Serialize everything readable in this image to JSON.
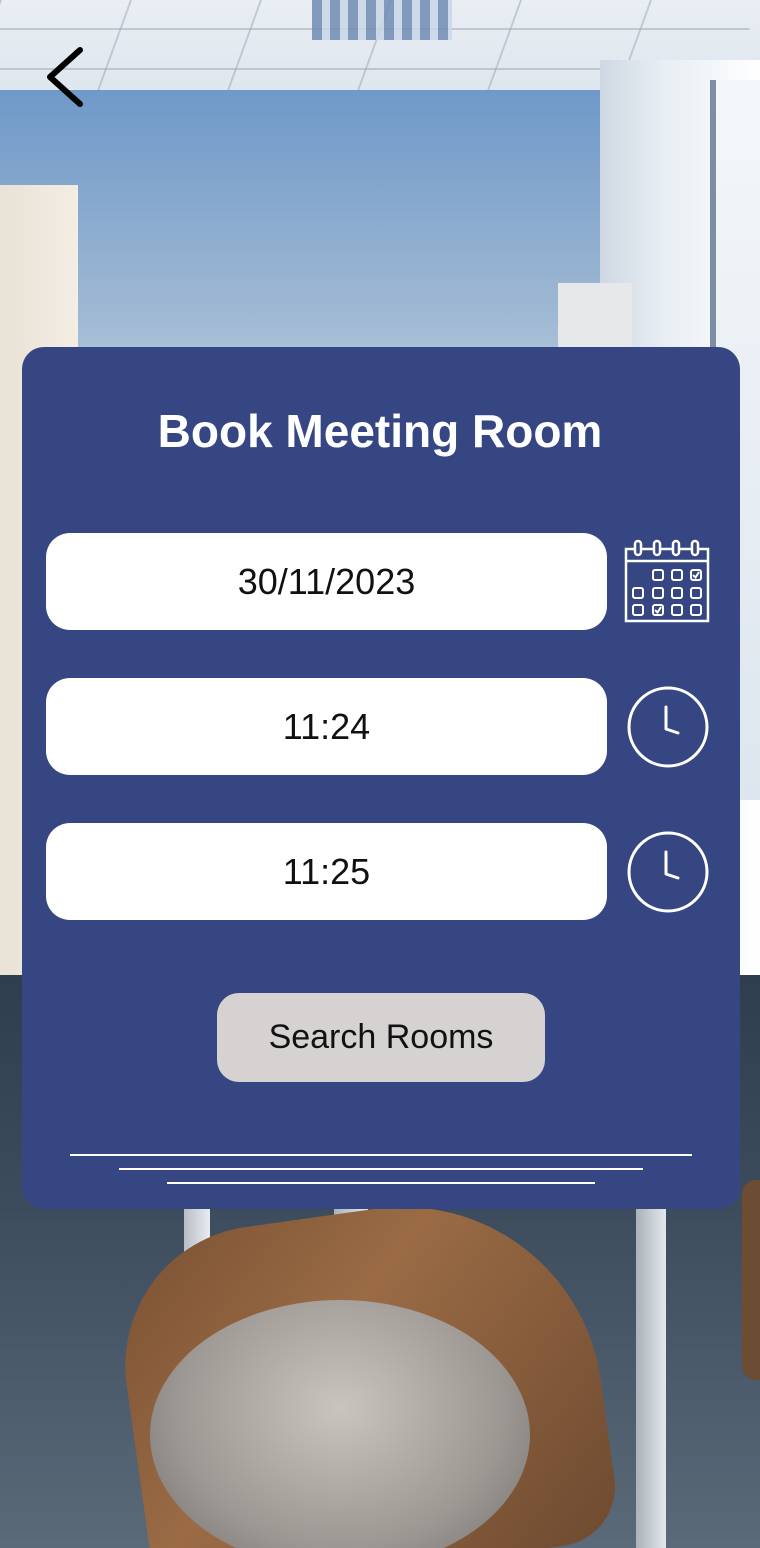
{
  "screen": {
    "title": "Book Meeting Room"
  },
  "form": {
    "date_value": "30/11/2023",
    "start_time_value": "11:24",
    "end_time_value": "11:25",
    "search_label": "Search Rooms"
  },
  "icons": {
    "back": "chevron-left-icon",
    "date": "calendar-icon",
    "start_time": "clock-icon",
    "end_time": "clock-icon"
  },
  "colors": {
    "card_background": "#354682",
    "field_background": "#ffffff",
    "button_background": "#d6d2d2",
    "title_text": "#ffffff"
  }
}
